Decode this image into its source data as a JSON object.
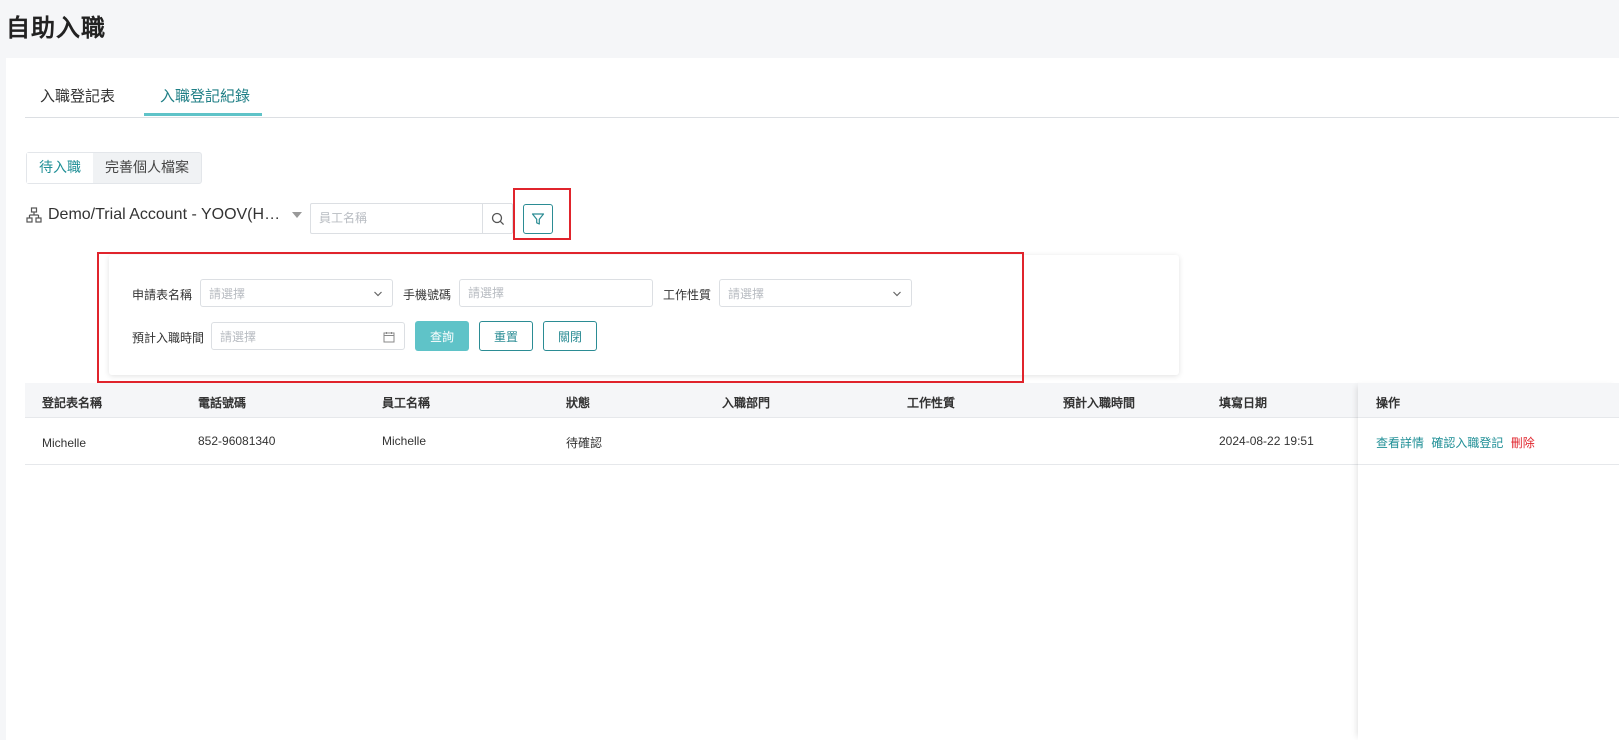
{
  "page": {
    "title": "自助入職"
  },
  "tabs": [
    {
      "label": "入職登記表",
      "active": false
    },
    {
      "label": "入職登記紀錄",
      "active": true
    }
  ],
  "segments": [
    {
      "label": "待入職",
      "active": true
    },
    {
      "label": "完善個人檔案",
      "active": false
    }
  ],
  "org": {
    "name": "Demo/Trial Account - YOOV(H…"
  },
  "search": {
    "placeholder": "員工名稱"
  },
  "filter": {
    "form_name": {
      "label": "申請表名稱",
      "placeholder": "請選擇"
    },
    "phone": {
      "label": "手機號碼",
      "placeholder": "請選擇"
    },
    "job_nature": {
      "label": "工作性質",
      "placeholder": "請選擇"
    },
    "expected_date": {
      "label": "預計入職時間",
      "placeholder": "請選擇"
    },
    "buttons": {
      "query": "查詢",
      "reset": "重置",
      "close": "關閉"
    }
  },
  "table": {
    "columns": [
      "登記表名稱",
      "電話號碼",
      "員工名稱",
      "狀態",
      "入職部門",
      "工作性質",
      "預計入職時間",
      "填寫日期",
      "操作"
    ],
    "rows": [
      {
        "form_name": "Michelle",
        "phone": "852-96081340",
        "employee": "Michelle",
        "status": "待確認",
        "department": "",
        "job_nature": "",
        "expected_date": "",
        "filled_date": "2024-08-22 19:51",
        "actions": [
          "查看詳情",
          "確認入職登記",
          "刪除"
        ]
      }
    ]
  },
  "colors": {
    "accent": "#5fc3c8",
    "accent_dark": "#1f8f96",
    "danger": "#e0242c",
    "highlight": "#e0242c"
  }
}
